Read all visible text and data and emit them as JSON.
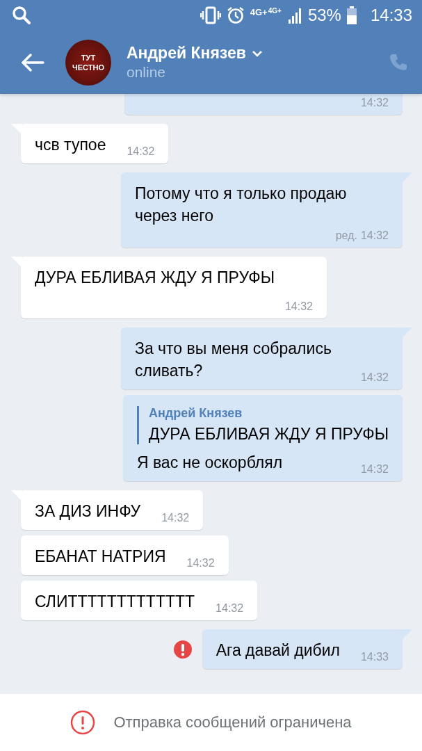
{
  "status_bar": {
    "network_1": "4G+",
    "network_2": "4G+",
    "battery": "53%",
    "time": "14:33"
  },
  "header": {
    "name": "Андрей Князев",
    "status": "online",
    "avatar_lines": [
      "ТУТ",
      "ЧЕСТНО"
    ]
  },
  "messages": [
    {
      "kind": "outgoing",
      "tail": false,
      "time": "14:32"
    },
    {
      "kind": "incoming",
      "tail": true,
      "text": "чсв тупое",
      "time": "14:32"
    },
    {
      "kind": "outgoing",
      "tail": true,
      "text": "Потому что я только продаю через него",
      "edited": "ред.",
      "time": "14:32"
    },
    {
      "kind": "incoming",
      "tail": true,
      "text": "ДУРА ЕБЛИВАЯ ЖДУ Я ПРУФЫ",
      "time": "14:32"
    },
    {
      "kind": "outgoing",
      "tail": true,
      "text": "За что вы меня собрались сливать?",
      "time": "14:32"
    },
    {
      "kind": "outgoing",
      "tail": false,
      "reply": {
        "author": "Андрей Князев",
        "text": "ДУРА ЕБЛИВАЯ ЖДУ Я ПРУФЫ"
      },
      "text": "Я вас не оскорблял",
      "time": "14:32"
    },
    {
      "kind": "incoming",
      "tail": true,
      "text": "ЗА ДИЗ ИНФУ",
      "time": "14:32"
    },
    {
      "kind": "incoming",
      "tail": false,
      "text": "ЕБАНАТ НАТРИЯ",
      "time": "14:32"
    },
    {
      "kind": "incoming",
      "tail": false,
      "text": "СЛИТТТТТТТТТТТТТ",
      "time": "14:32"
    },
    {
      "kind": "outgoing",
      "tail": true,
      "failed": true,
      "text": "Ага давай дибил",
      "time": "14:33"
    }
  ],
  "footer": {
    "notice": "Отправка сообщений ограничена"
  }
}
